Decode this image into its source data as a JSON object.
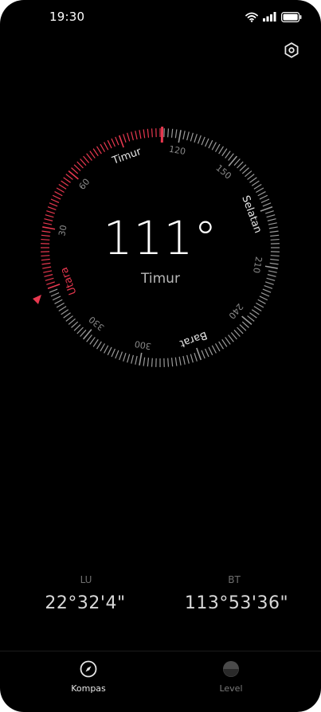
{
  "status_bar": {
    "time": "19:30"
  },
  "settings": {
    "icon": "gear-icon"
  },
  "compass": {
    "heading_degrees": 111,
    "heading_text": "111°",
    "direction_text": "Timur",
    "cardinal_labels": {
      "north": "Utara",
      "east": "Timur",
      "south": "Selatan",
      "west": "Barat"
    },
    "degree_labels": [
      "30",
      "60",
      "120",
      "150",
      "210",
      "240",
      "300",
      "330"
    ],
    "accent_color": "#e8384f",
    "tick_color": "#9a9a9a"
  },
  "coordinates": {
    "latitude_label": "LU",
    "latitude_value": "22°32'4\"",
    "longitude_label": "BT",
    "longitude_value": "113°53'36\""
  },
  "nav": {
    "compass_label": "Kompas",
    "level_label": "Level"
  }
}
